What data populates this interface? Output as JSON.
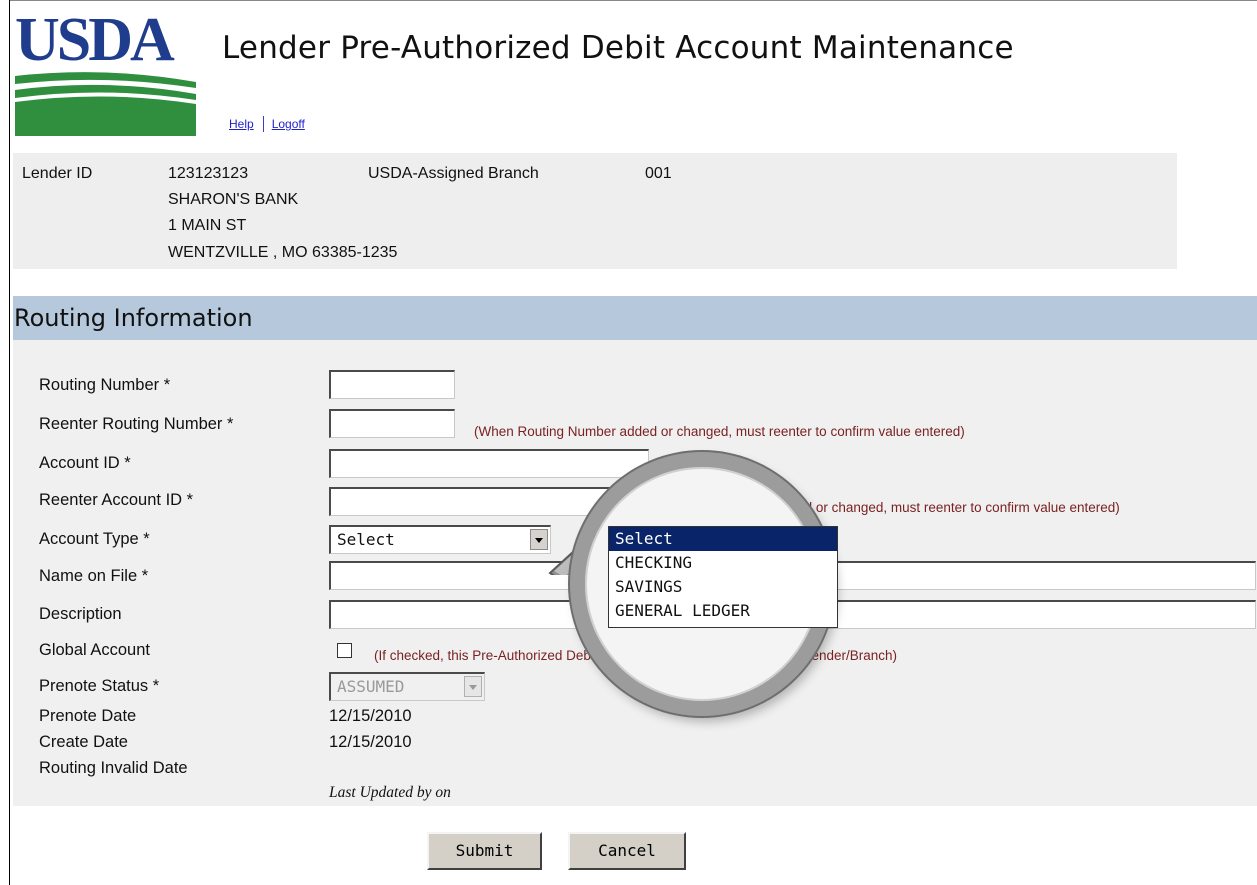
{
  "header": {
    "logo_text": "USDA",
    "title": "Lender Pre-Authorized Debit Account Maintenance",
    "links": {
      "help": "Help",
      "logoff": "Logoff"
    }
  },
  "lender": {
    "id_label": "Lender ID",
    "id": "123123123",
    "branch_label": "USDA-Assigned Branch",
    "branch": "001",
    "name": "SHARON'S BANK",
    "street": "1 MAIN ST",
    "city_state_zip": "WENTZVILLE , MO 63385-1235"
  },
  "section": {
    "title": "Routing Information"
  },
  "form": {
    "routing_number": {
      "label": "Routing Number *",
      "value": ""
    },
    "reenter_routing_number": {
      "label": "Reenter Routing Number *",
      "value": "",
      "hint": "(When Routing Number added or changed, must reenter to confirm value entered)"
    },
    "account_id": {
      "label": "Account ID *",
      "value": ""
    },
    "reenter_account_id": {
      "label": "Reenter Account ID *",
      "value": "",
      "hint": "(When Account ID added or changed, must reenter to confirm value entered)"
    },
    "account_type": {
      "label": "Account Type *",
      "selected": "Select",
      "options": [
        "Select",
        "CHECKING",
        "SAVINGS",
        "GENERAL LEDGER"
      ]
    },
    "name_on_file": {
      "label": "Name on File *",
      "value": ""
    },
    "description": {
      "label": "Description",
      "value": ""
    },
    "global_account": {
      "label": "Global Account",
      "checked": false,
      "hint": "(If checked, this Pre-Authorized Debit Account will be available for each Lender/Branch)"
    },
    "prenote_status": {
      "label": "Prenote Status *",
      "selected": "ASSUMED",
      "disabled": true
    },
    "prenote_date": {
      "label": "Prenote Date",
      "value": "12/15/2010"
    },
    "create_date": {
      "label": "Create Date",
      "value": "12/15/2010"
    },
    "routing_invalid_date": {
      "label": "Routing Invalid Date",
      "value": ""
    },
    "last_updated": "Last Updated by  on"
  },
  "buttons": {
    "submit": "Submit",
    "cancel": "Cancel"
  },
  "colors": {
    "section_bar": "#b5c8dc",
    "hint_text": "#7a2222",
    "dropdown_selected": "#0a246a",
    "logo_blue": "#1f3d8c",
    "logo_green": "#2f8f3f"
  },
  "icons": [
    "dropdown-arrow-icon",
    "magnifier-lens-icon"
  ]
}
